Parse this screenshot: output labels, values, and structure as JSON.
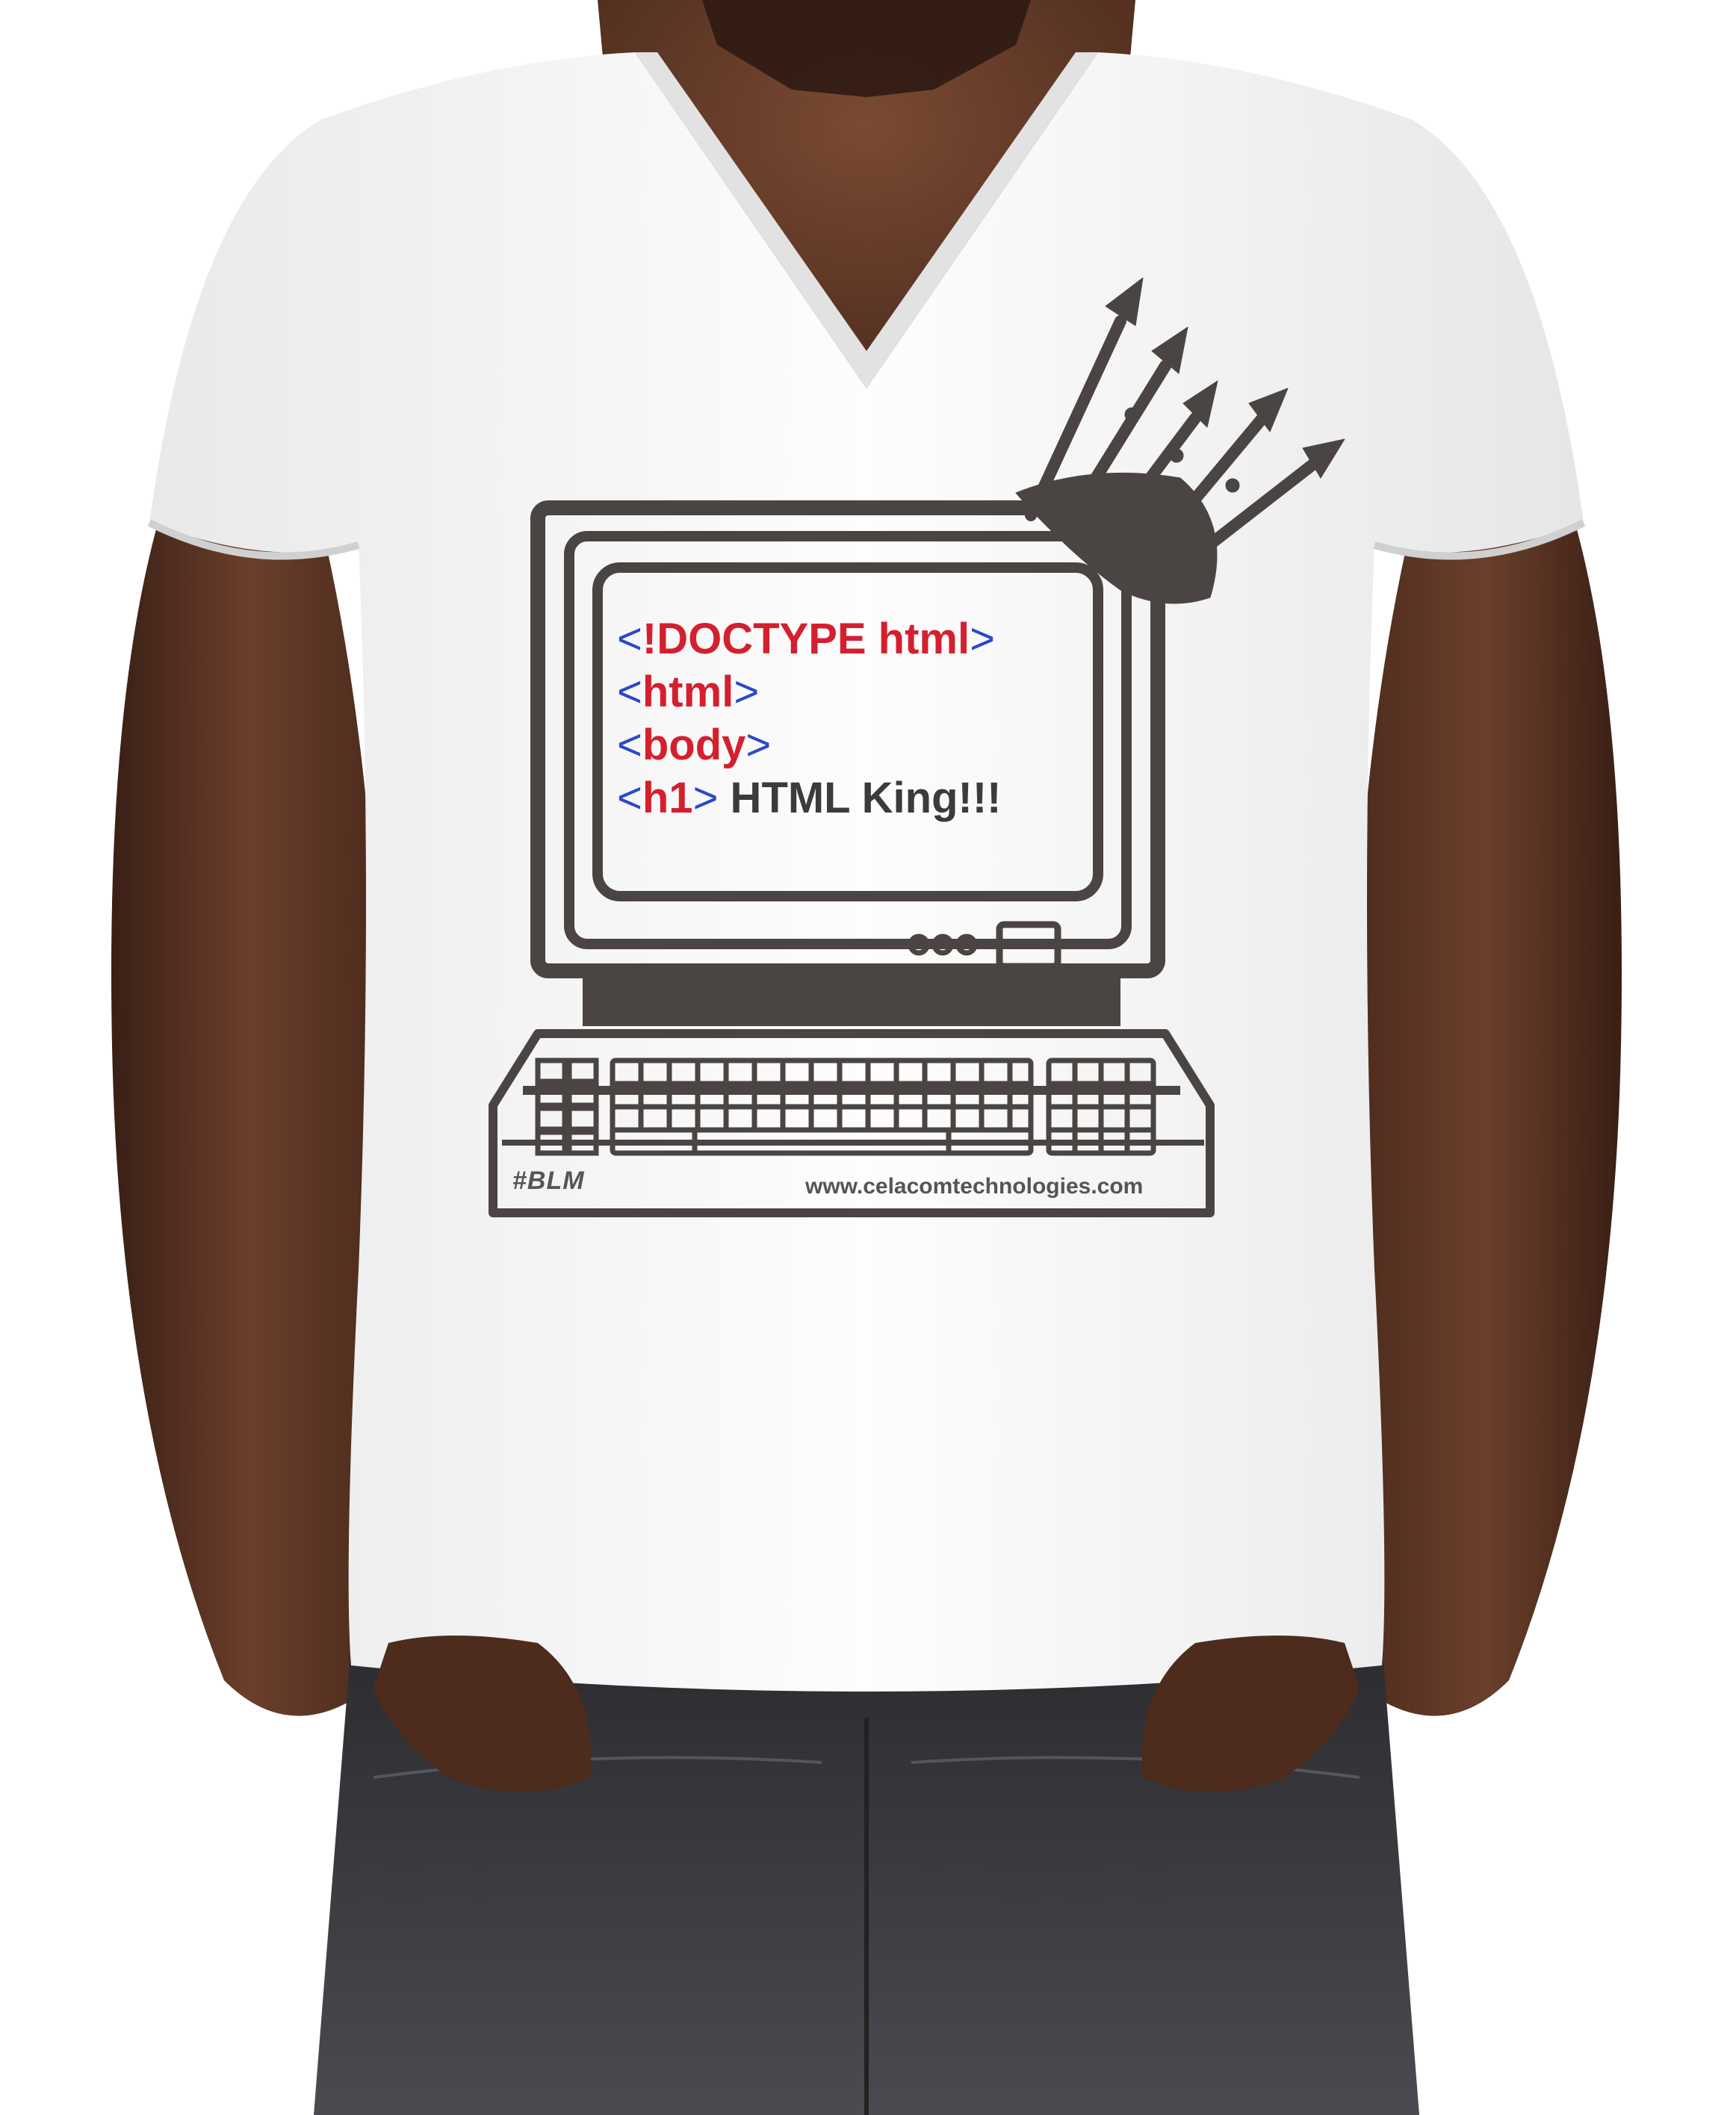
{
  "image": {
    "subject": "Man wearing white v-neck t-shirt with retro computer print",
    "colors": {
      "background": "#ffffff",
      "skin": "#5a3424",
      "shirt": "#f7f7f7",
      "jeans": "#3c3c40",
      "print": "#4a4543",
      "bracket_blue": "#2b49c8",
      "tag_red": "#d4202e"
    },
    "print": {
      "code_lines": [
        {
          "open": "<",
          "tag": "!DOCTYPE",
          "tag_rest": " html",
          "close": ">",
          "text": ""
        },
        {
          "open": "<",
          "tag": "html",
          "tag_rest": "",
          "close": ">",
          "text": ""
        },
        {
          "open": "<",
          "tag": "body",
          "tag_rest": "",
          "close": ">",
          "text": ""
        },
        {
          "open": "<",
          "tag": "h1",
          "tag_rest": "",
          "close": ">",
          "text": " HTML King!!!"
        }
      ],
      "hashtag": "#BLM",
      "website": "www.celacomtechnologies.com",
      "icons": [
        "crown-icon",
        "computer-monitor-icon",
        "keyboard-icon"
      ]
    }
  }
}
